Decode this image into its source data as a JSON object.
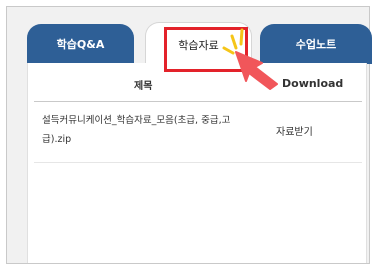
{
  "tabs": [
    {
      "label": "학습Q&A",
      "active": false
    },
    {
      "label": "학습자료",
      "active": true
    },
    {
      "label": "수업노트",
      "active": false
    }
  ],
  "table": {
    "headers": {
      "title": "제목",
      "download": "Download"
    },
    "rows": [
      {
        "title": "설득커뮤니케이션_학습자료_모음(초급, 중급,고급).zip",
        "download": "자료받기"
      }
    ]
  },
  "colors": {
    "tab_inactive": "#2e5f96",
    "highlight": "#e3222a",
    "pointer": "#f1565a",
    "burst": "#f5c518"
  },
  "icons": {
    "pointer": "hand-pointer-icon"
  }
}
